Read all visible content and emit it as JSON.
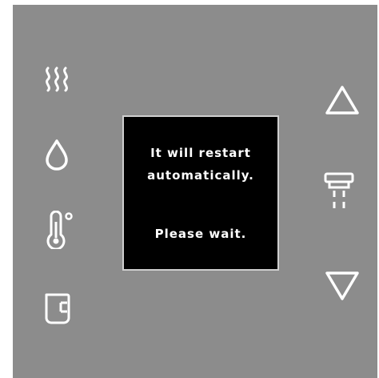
{
  "display": {
    "line1": "It will restart",
    "line2": "automatically.",
    "line3": "Please wait."
  },
  "icons": {
    "left": [
      "steam-icon",
      "water-drop-icon",
      "thermometer-icon",
      "cup-icon"
    ],
    "right": [
      "arrow-up-icon",
      "dispenser-icon",
      "arrow-down-icon"
    ]
  },
  "colors": {
    "panel": "#8c8c8c",
    "screen": "#000000",
    "icon": "#ffffff"
  }
}
